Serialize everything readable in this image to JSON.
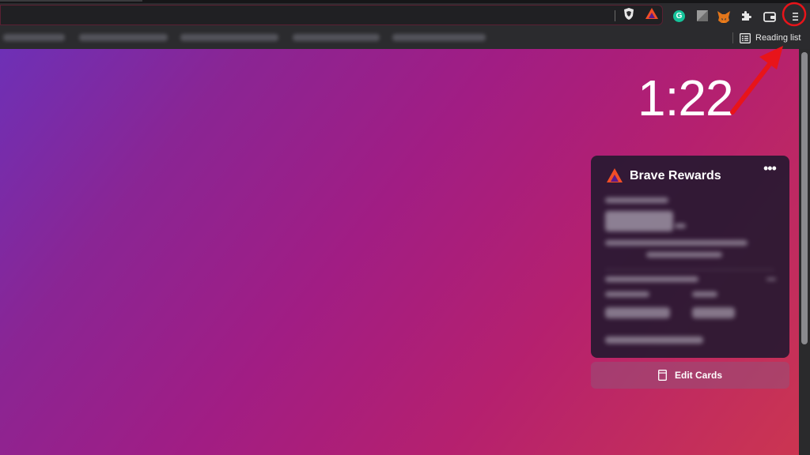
{
  "bookmarks_bar": {
    "reading_list_label": "Reading list"
  },
  "toolbar": {
    "menu_icon": "hamburger-menu-icon",
    "extension_icons": [
      "brave-shield-icon",
      "brave-rewards-icon",
      "grammarly-icon",
      "extension-grey-icon",
      "metamask-fox-icon",
      "puzzle-icon",
      "wallet-icon"
    ],
    "grammarly_letter": "G"
  },
  "new_tab": {
    "clock": "1:22",
    "rewards_card": {
      "title": "Brave Rewards",
      "more_label": "•••"
    },
    "edit_cards_label": "Edit Cards"
  },
  "colors": {
    "brave_orange": "#f24e27",
    "brave_purple": "#5a1b8c",
    "annotation_red": "#e8141a",
    "gradient_start": "#6e30b6",
    "gradient_end": "#cb3551"
  }
}
